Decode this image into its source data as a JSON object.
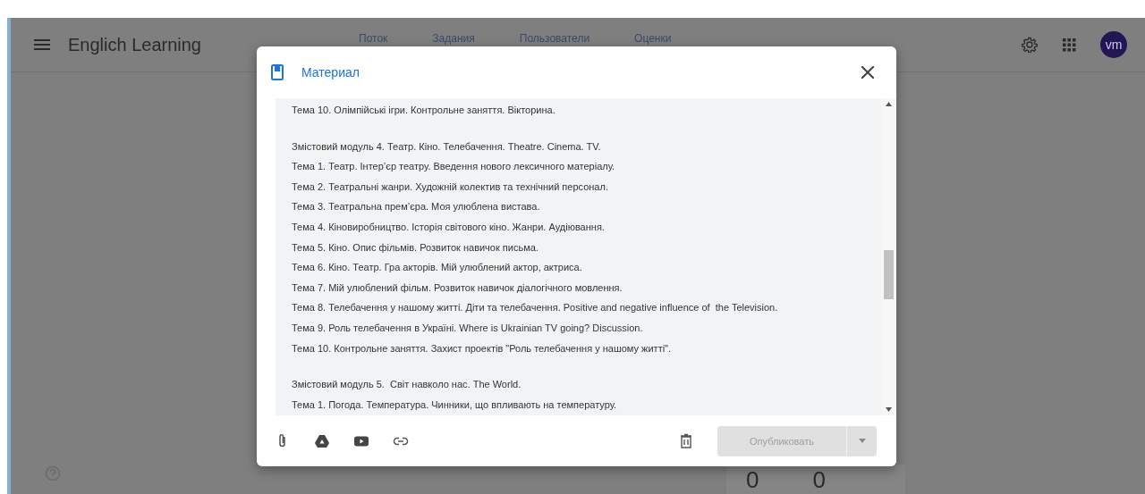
{
  "app": {
    "title": "Englich Learning",
    "avatar": "vm"
  },
  "tabs": [
    {
      "label": "Поток"
    },
    {
      "label": "Задания"
    },
    {
      "label": "Пользователи"
    },
    {
      "label": "Оценки"
    }
  ],
  "stats": [
    "0",
    "0"
  ],
  "dialog": {
    "title": "Материал",
    "blocks": [
      [
        "Тема 10. Олімпійські ігри. Контрольне заняття. Вікторина."
      ],
      [
        "Змістовий модуль 4. Театр. Кіно. Телебачення. Theatre. Cinema. TV.",
        "Тема 1. Театр. Інтер’єр театру. Введення нового лексичного матеріалу.",
        "Тема 2. Театральні жанри. Художній колектив та технічний персонал.",
        "Тема 3. Театральна прем’єра. Моя улюблена вистава.",
        "Тема 4. Кіновиробництво. Історія світового кіно. Жанри. Аудіювання.",
        "Тема 5. Кіно. Опис фільмів. Розвиток навичок письма.",
        "Тема 6. Кіно. Театр. Гра акторів. Мій улюблений актор, актриса.",
        "Тема 7. Мій улюблений фільм. Розвиток навичок діалогічного мовлення.",
        "Тема 8. Телебачення у нашому житті. Діти та телебачення. Positive and negative influence of  the Television.",
        "Тема 9. Роль телебачення в Україні. Where is Ukrainian TV going? Discussion.",
        "Тема 10. Контрольне заняття. Захист проектів \"Роль телебачення у нашому житті\"."
      ],
      [
        "Змістовий модуль 5.  Світ навколо нас. The World.",
        "Тема 1. Погода. Температура. Чинники, що впливають на температуру."
      ]
    ],
    "publish": {
      "label": "Опубликовать",
      "disabled": true
    }
  }
}
